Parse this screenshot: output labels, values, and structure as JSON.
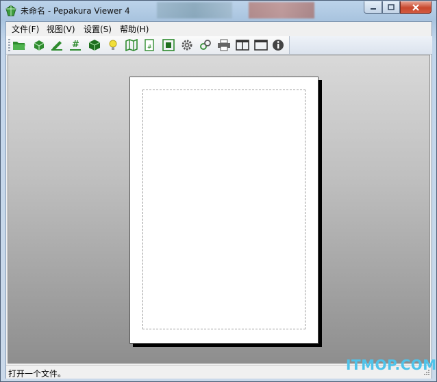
{
  "window": {
    "title": "未命名 - Pepakura Viewer 4"
  },
  "menu": [
    {
      "label": "文件(F)"
    },
    {
      "label": "视图(V)"
    },
    {
      "label": "设置(S)"
    },
    {
      "label": "帮助(H)"
    }
  ],
  "toolbar": {
    "icons": [
      "open-folder-icon",
      "3d-view-icon",
      "edit-icon",
      "number-icon",
      "cube-icon",
      "lightbulb-icon",
      "unfold-map-icon",
      "page-number-icon",
      "fit-view-icon",
      "gear-icon",
      "glasses-view-icon",
      "printer-icon",
      "split-view-icon",
      "single-view-icon",
      "info-icon"
    ]
  },
  "status": {
    "text": "打开一个文件。"
  },
  "watermark": {
    "text": "ITMOP.COM"
  },
  "colors": {
    "accent_green": "#2e8b2e",
    "watermark": "#4fc3ea",
    "close_button": "#c8482e"
  }
}
